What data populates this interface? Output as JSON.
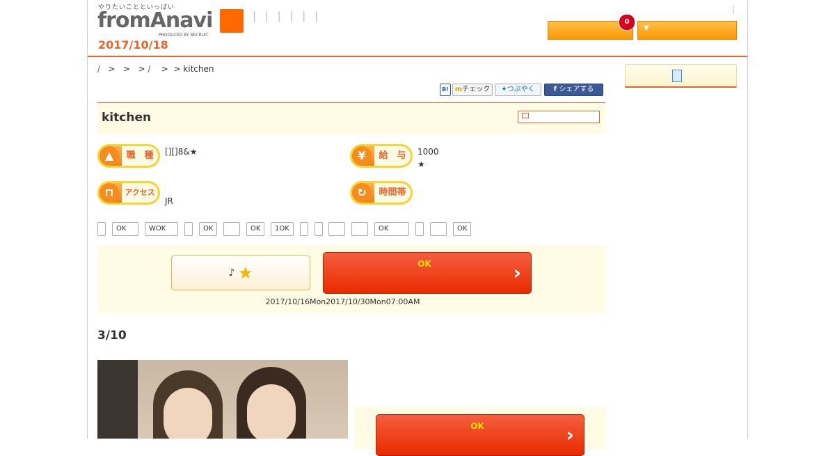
{
  "header": {
    "tagline": "やりたいことといっぱい",
    "logo": "fromAnavi",
    "produced": "PRODUCED BY RECRUIT",
    "date": "2017/10/18",
    "nav_sep": "| | | | | |",
    "pipe": "|",
    "cart_count": "0",
    "dropdown_arrow": "▼"
  },
  "breadcrumb": {
    "items": [
      "/",
      ">",
      ">",
      ">",
      "/",
      ">",
      "> kitchen"
    ]
  },
  "share": {
    "hatena": "B!",
    "mixi": "チェック",
    "twitter": "つぶやく",
    "facebook": "シェアする"
  },
  "job": {
    "title": "kitchen",
    "occupation_label": "職　種",
    "occupation_value": "[][]8&★",
    "salary_label": "給　与",
    "salary_value": "1000",
    "salary_note": "★",
    "access_label": "アクセス",
    "access_value": "JR",
    "hours_label": "時間帯",
    "tags": [
      "",
      "OK",
      "WOK",
      "",
      "OK",
      "",
      "OK",
      "1OK",
      "",
      "",
      "",
      "",
      "OK",
      "",
      "",
      "OK"
    ]
  },
  "apply": {
    "keep_label": "♪",
    "ok_label": "OK",
    "period": "2017/10/16Mon2017/10/30Mon07:00AM"
  },
  "photos": {
    "title": "3/10"
  },
  "colors": {
    "accent": "#e8662a",
    "apply_red": "#e82a00",
    "cream": "#fffbe5"
  }
}
